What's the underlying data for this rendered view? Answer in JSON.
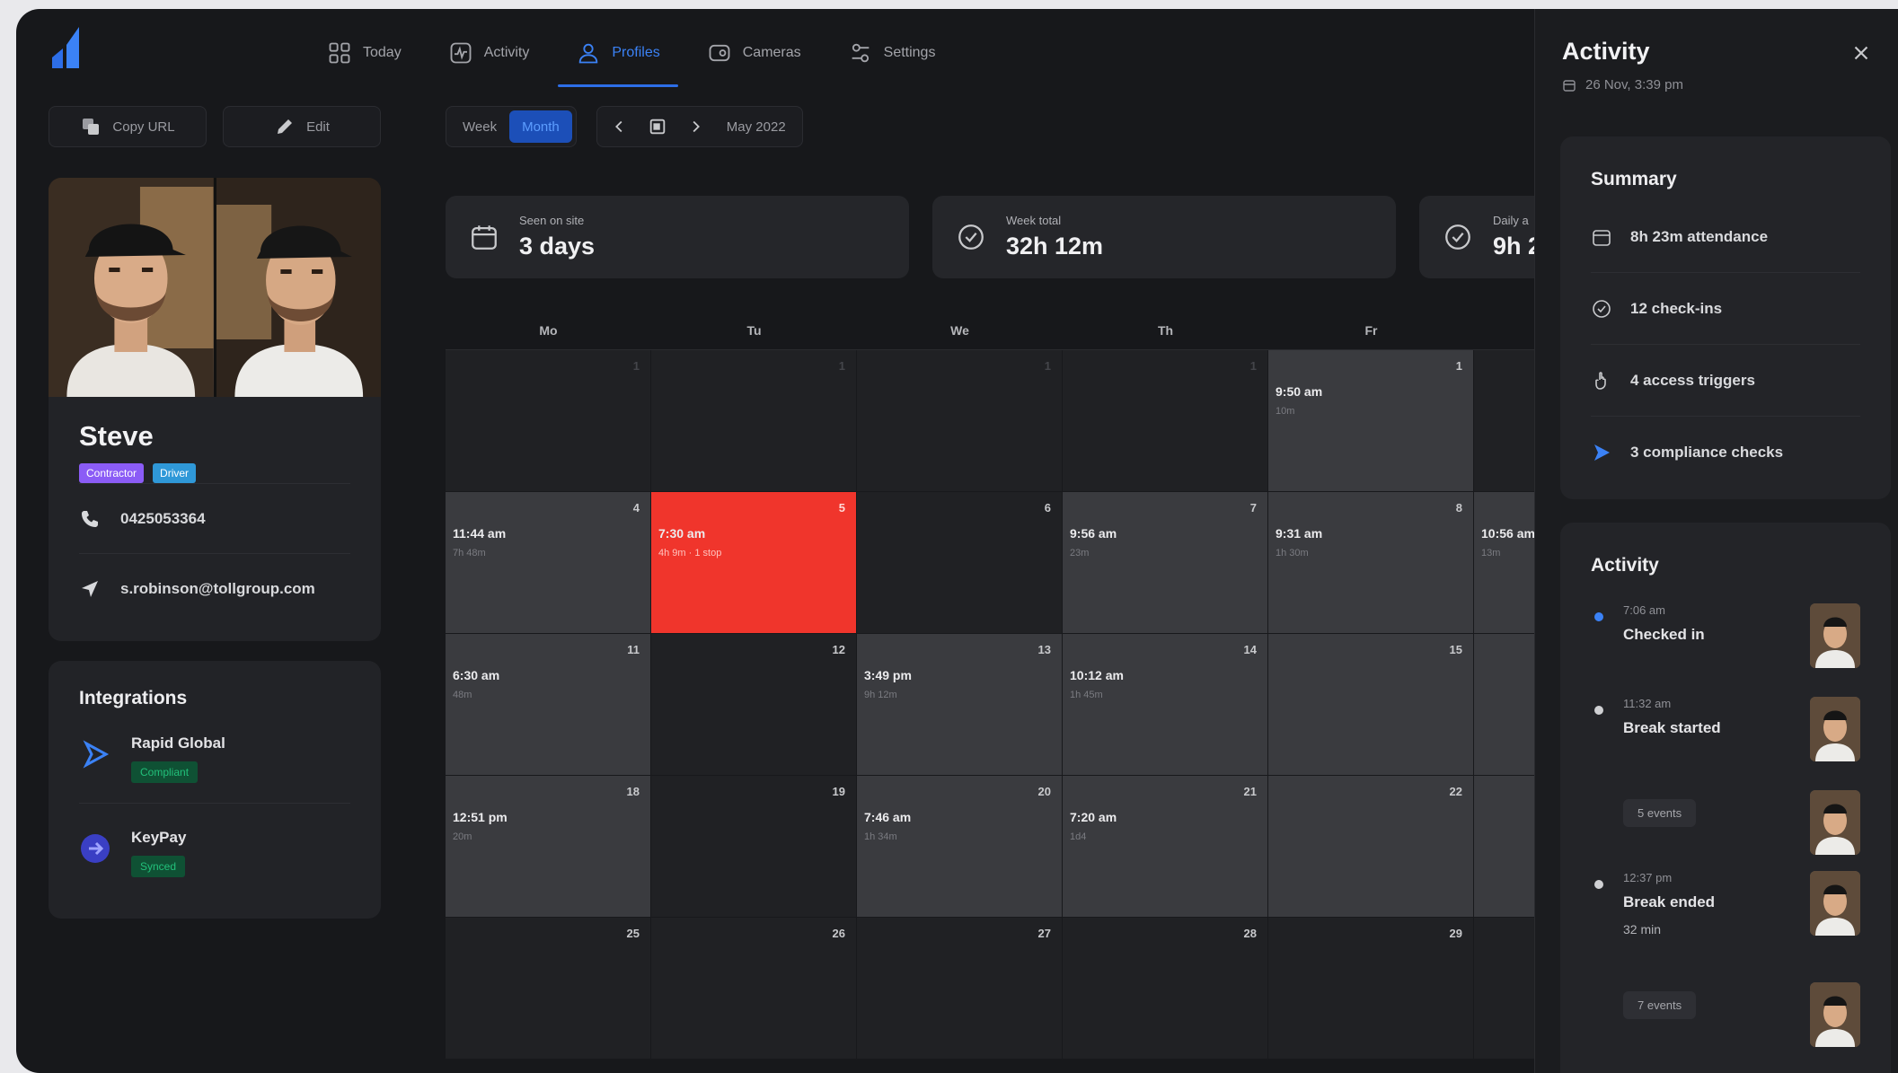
{
  "nav": {
    "items": [
      {
        "label": "Today",
        "icon": "grid-icon",
        "active": false
      },
      {
        "label": "Activity",
        "icon": "pulse-icon",
        "active": false
      },
      {
        "label": "Profiles",
        "icon": "user-icon",
        "active": true
      },
      {
        "label": "Cameras",
        "icon": "camera-icon",
        "active": false
      },
      {
        "label": "Settings",
        "icon": "sliders-icon",
        "active": false
      }
    ]
  },
  "actions": {
    "copy_url": "Copy URL",
    "edit": "Edit"
  },
  "profile": {
    "name": "Steve",
    "badges": [
      "Contractor",
      "Driver"
    ],
    "phone": "0425053364",
    "email": "s.robinson@tollgroup.com"
  },
  "integrations": {
    "heading": "Integrations",
    "items": [
      {
        "name": "Rapid Global",
        "status": "Compliant"
      },
      {
        "name": "KeyPay",
        "status": "Synced"
      }
    ]
  },
  "toolbar": {
    "week": "Week",
    "month": "Month",
    "period": "May 2022"
  },
  "stats": [
    {
      "label": "Seen on site",
      "value": "3 days"
    },
    {
      "label": "Week total",
      "value": "32h 12m"
    },
    {
      "label": "Daily a",
      "value": "9h 2"
    }
  ],
  "calendar": {
    "weekdays": [
      "Mo",
      "Tu",
      "We",
      "Th",
      "Fr",
      ""
    ],
    "rows": [
      [
        {
          "day": "1",
          "state": "muted"
        },
        {
          "day": "1",
          "state": "muted"
        },
        {
          "day": "1",
          "state": "muted"
        },
        {
          "day": "1",
          "state": "muted"
        },
        {
          "day": "1",
          "state": "has",
          "time": "9:50 am",
          "sub": "10m"
        },
        {
          "day": "",
          "state": "empty"
        }
      ],
      [
        {
          "day": "4",
          "state": "has",
          "time": "11:44 am",
          "sub": "7h 48m"
        },
        {
          "day": "5",
          "state": "alert",
          "time": "7:30 am",
          "sub": "4h 9m · 1 stop"
        },
        {
          "day": "6",
          "state": "empty"
        },
        {
          "day": "7",
          "state": "has",
          "time": "9:56 am",
          "sub": "23m"
        },
        {
          "day": "8",
          "state": "has",
          "time": "9:31 am",
          "sub": "1h 30m"
        },
        {
          "day": "",
          "state": "has",
          "time": "10:56 am",
          "sub": "13m"
        }
      ],
      [
        {
          "day": "11",
          "state": "has",
          "time": "6:30 am",
          "sub": "48m"
        },
        {
          "day": "12",
          "state": "empty"
        },
        {
          "day": "13",
          "state": "has",
          "time": "3:49 pm",
          "sub": "9h 12m"
        },
        {
          "day": "14",
          "state": "has",
          "time": "10:12 am",
          "sub": "1h 45m"
        },
        {
          "day": "15",
          "state": "has"
        },
        {
          "day": "",
          "state": "has"
        }
      ],
      [
        {
          "day": "18",
          "state": "has",
          "time": "12:51 pm",
          "sub": "20m"
        },
        {
          "day": "19",
          "state": "empty"
        },
        {
          "day": "20",
          "state": "has",
          "time": "7:46 am",
          "sub": "1h 34m"
        },
        {
          "day": "21",
          "state": "has",
          "time": "7:20 am",
          "sub": "1d4"
        },
        {
          "day": "22",
          "state": "has"
        },
        {
          "day": "",
          "state": "has"
        }
      ],
      [
        {
          "day": "25",
          "state": "empty"
        },
        {
          "day": "26",
          "state": "empty"
        },
        {
          "day": "27",
          "state": "empty"
        },
        {
          "day": "28",
          "state": "empty"
        },
        {
          "day": "29",
          "state": "empty"
        },
        {
          "day": "",
          "state": "empty"
        }
      ]
    ]
  },
  "panel": {
    "title": "Activity",
    "date": "26 Nov, 3:39 pm",
    "summary": {
      "heading": "Summary",
      "rows": [
        {
          "icon": "calendar-icon",
          "text": "8h 23m attendance"
        },
        {
          "icon": "check-circle-icon",
          "text": "12 check-ins"
        },
        {
          "icon": "hand-icon",
          "text": "4 access triggers"
        },
        {
          "icon": "compliance-icon",
          "text": "3 compliance checks"
        }
      ]
    },
    "activity": {
      "heading": "Activity",
      "feed": [
        {
          "time": "7:06 am",
          "title": "Checked in",
          "dot": "blue"
        },
        {
          "time": "11:32 am",
          "title": "Break started",
          "dot": "grey"
        },
        {
          "chip": "5 events"
        },
        {
          "time": "12:37 pm",
          "title": "Break ended",
          "sub": "32 min",
          "dot": "grey"
        },
        {
          "chip": "7 events"
        }
      ]
    }
  },
  "colors": {
    "background": "#17181b",
    "card": "#222327",
    "accent": "#2d6ee8",
    "alert": "#f0352c",
    "compliant": "#22c07a"
  }
}
